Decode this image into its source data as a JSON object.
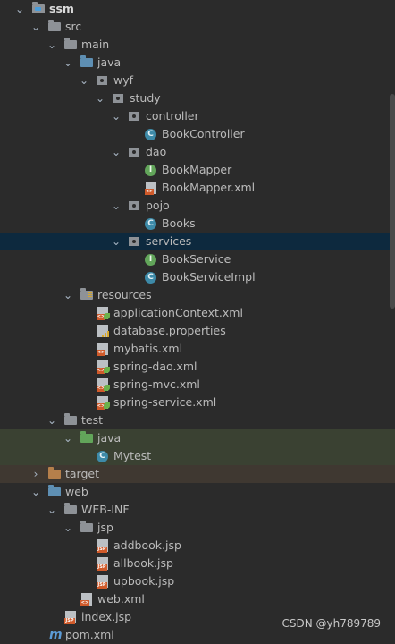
{
  "tree": {
    "root": "ssm",
    "src": "src",
    "main": "main",
    "java": "java",
    "wyf": "wyf",
    "study": "study",
    "controller": "controller",
    "BookController": "BookController",
    "dao": "dao",
    "BookMapper": "BookMapper",
    "BookMapperXml": "BookMapper.xml",
    "pojo": "pojo",
    "Books": "Books",
    "services": "services",
    "BookService": "BookService",
    "BookServiceImpl": "BookServiceImpl",
    "resources": "resources",
    "applicationContext": "applicationContext.xml",
    "databaseProps": "database.properties",
    "mybatis": "mybatis.xml",
    "springDao": "spring-dao.xml",
    "springMvc": "spring-mvc.xml",
    "springService": "spring-service.xml",
    "test": "test",
    "testJava": "java",
    "Mytest": "Mytest",
    "target": "target",
    "web": "web",
    "webinf": "WEB-INF",
    "jsp": "jsp",
    "addbook": "addbook.jsp",
    "allbook": "allbook.jsp",
    "upbook": "upbook.jsp",
    "webxml": "web.xml",
    "index": "index.jsp",
    "pom": "pom.xml"
  },
  "icon_labels": {
    "class": "C",
    "interface": "I",
    "xml": "<>",
    "jsp": "JSP",
    "maven": "m"
  },
  "watermark": "CSDN @yh789789"
}
